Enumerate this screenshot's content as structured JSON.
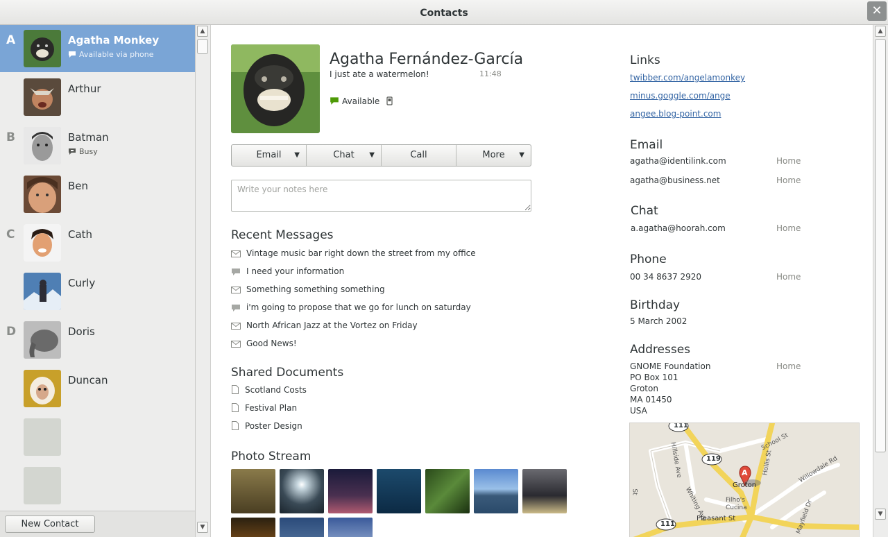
{
  "window": {
    "title": "Contacts",
    "close_glyph": "✕"
  },
  "sidebar": {
    "contacts": [
      {
        "letter": "A",
        "name": "Agatha Monkey",
        "status": "Available via phone",
        "status_icon": "phone-available-icon",
        "selected": true
      },
      {
        "letter": "",
        "name": "Arthur",
        "status": ""
      },
      {
        "letter": "B",
        "name": "Batman",
        "status": "Busy",
        "status_icon": "busy-icon"
      },
      {
        "letter": "",
        "name": "Ben",
        "status": ""
      },
      {
        "letter": "C",
        "name": "Cath",
        "status": ""
      },
      {
        "letter": "",
        "name": "Curly",
        "status": ""
      },
      {
        "letter": "D",
        "name": "Doris",
        "status": ""
      },
      {
        "letter": "",
        "name": "Duncan",
        "status": ""
      }
    ],
    "new_contact_label": "New Contact"
  },
  "details": {
    "full_name": "Agatha Fernández-García",
    "status_message": "I just ate a watermelon!",
    "status_time": "11:48",
    "presence": "Available",
    "presence_color": "#4e9a06",
    "actions": {
      "email": "Email",
      "chat": "Chat",
      "call": "Call",
      "more": "More"
    },
    "notes_placeholder": "Write your notes here",
    "recent_messages": {
      "title": "Recent Messages",
      "items": [
        {
          "type": "email",
          "text": "Vintage music bar right down the street from my office"
        },
        {
          "type": "chat",
          "text": "I need your information"
        },
        {
          "type": "email",
          "text": "Something something something"
        },
        {
          "type": "chat",
          "text": "i'm going to propose that we go for lunch on saturday"
        },
        {
          "type": "email",
          "text": "North African Jazz at the Vortez on Friday"
        },
        {
          "type": "email",
          "text": "Good News!"
        }
      ]
    },
    "shared_documents": {
      "title": "Shared Documents",
      "items": [
        "Scotland Costs",
        "Festival Plan",
        "Poster Design"
      ]
    },
    "photo_stream": {
      "title": "Photo Stream"
    },
    "links": {
      "title": "Links",
      "items": [
        "twibber.com/angelamonkey",
        "minus.goggle.com/ange",
        "angee.blog-point.com"
      ]
    },
    "email": {
      "title": "Email",
      "items": [
        {
          "value": "agatha@identilink.com",
          "type": "Home"
        },
        {
          "value": "agatha@business.net",
          "type": "Home"
        }
      ]
    },
    "chat": {
      "title": "Chat",
      "items": [
        {
          "value": "a.agatha@hoorah.com",
          "type": "Home"
        }
      ]
    },
    "phone": {
      "title": "Phone",
      "items": [
        {
          "value": "00 34 8637 2920",
          "type": "Home"
        }
      ]
    },
    "birthday": {
      "title": "Birthday",
      "value": "5 March 2002"
    },
    "addresses": {
      "title": "Addresses",
      "type": "Home",
      "lines": [
        "GNOME Foundation",
        "PO Box 101",
        "Groton",
        "MA 01450",
        "USA"
      ]
    },
    "map": {
      "labels": [
        "School St",
        "Hillside Ave",
        "Hollis St",
        "Willowdale Rd",
        "Whiting Ave",
        "Pleasant St",
        "Groton",
        "Filho's Cucina",
        "Mayfield Dr",
        "St"
      ],
      "route_shields": [
        "111",
        "119",
        "111"
      ],
      "marker": "A"
    }
  }
}
